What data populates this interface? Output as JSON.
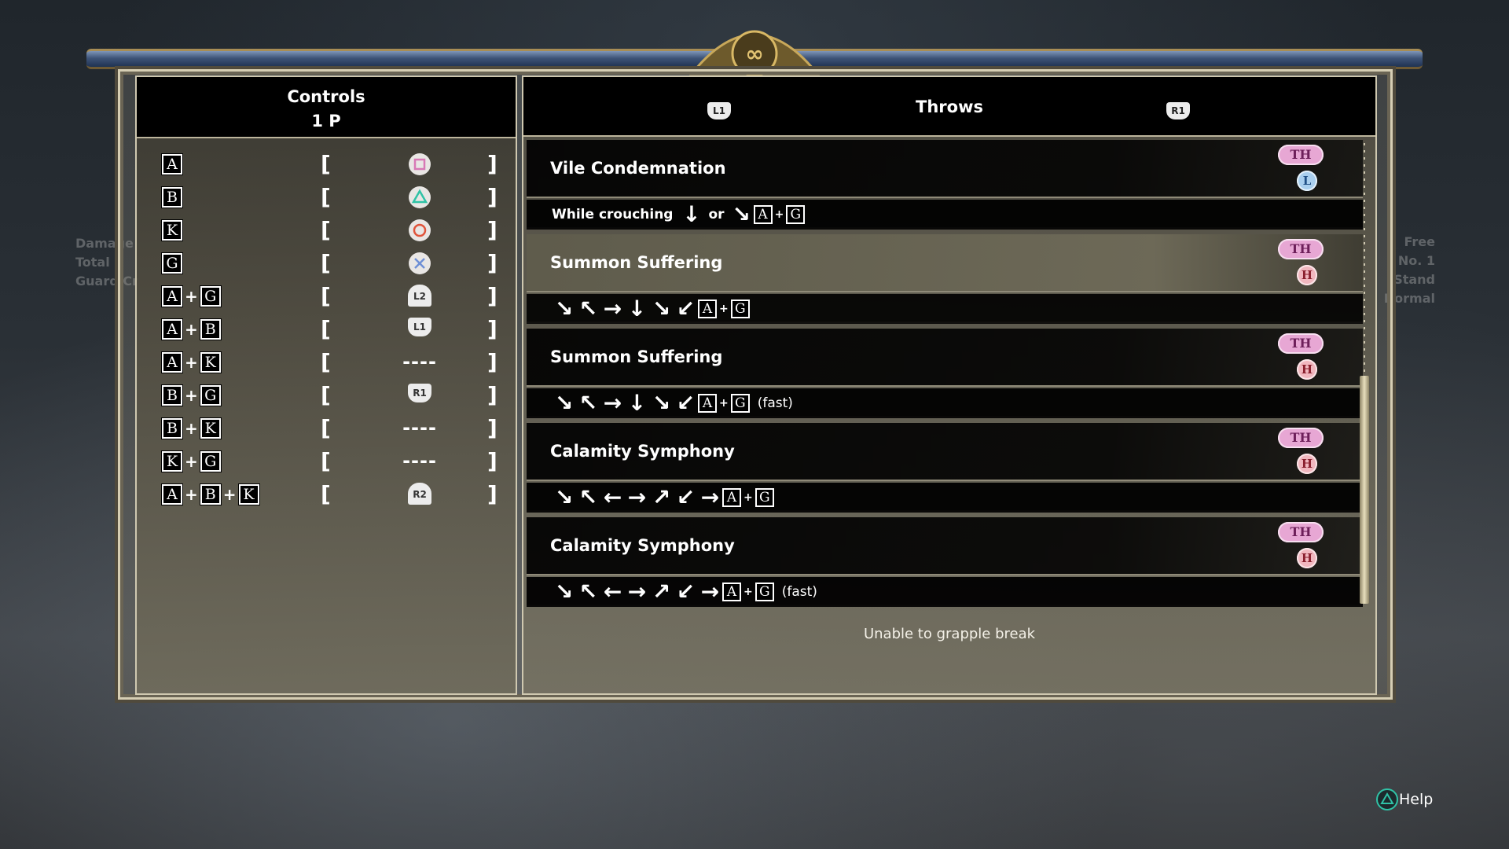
{
  "background": {
    "left_stats": [
      "Damage",
      "Total",
      "Guard Cr"
    ],
    "right_stats": [
      "Free",
      "No. 1",
      "Stand",
      "Normal"
    ]
  },
  "controls": {
    "title": "Controls",
    "player": "1 P",
    "rows": [
      {
        "keys": [
          "A"
        ],
        "button": "square-icon",
        "label": ""
      },
      {
        "keys": [
          "B"
        ],
        "button": "triangle-icon",
        "label": ""
      },
      {
        "keys": [
          "K"
        ],
        "button": "circle-icon",
        "label": ""
      },
      {
        "keys": [
          "G"
        ],
        "button": "cross-icon",
        "label": ""
      },
      {
        "keys": [
          "A",
          "G"
        ],
        "button": "l2-trigger",
        "label": "L2"
      },
      {
        "keys": [
          "A",
          "B"
        ],
        "button": "l1-shoulder",
        "label": "L1"
      },
      {
        "keys": [
          "A",
          "K"
        ],
        "button": "none",
        "label": "----"
      },
      {
        "keys": [
          "B",
          "G"
        ],
        "button": "r1-shoulder",
        "label": "R1"
      },
      {
        "keys": [
          "B",
          "K"
        ],
        "button": "none",
        "label": "----"
      },
      {
        "keys": [
          "K",
          "G"
        ],
        "button": "none",
        "label": "----"
      },
      {
        "keys": [
          "A",
          "B",
          "K"
        ],
        "button": "r2-trigger",
        "label": "R2"
      }
    ],
    "bracket_open": "[",
    "bracket_close": "]"
  },
  "throws": {
    "title": "Throws",
    "prev_tab_button": "L1",
    "next_tab_button": "R1",
    "moves": [
      {
        "name": "Vile Condemnation",
        "type_tag": "TH",
        "level_tag": "L",
        "prefix": "While crouching",
        "alt_word": "or",
        "command": [
          "↓",
          "or",
          "↘",
          "A",
          "+",
          "G"
        ],
        "suffix": ""
      },
      {
        "name": "Summon Suffering",
        "type_tag": "TH",
        "level_tag": "H",
        "prefix": "",
        "command": [
          "↘",
          "↖",
          "→",
          "↓",
          "↘",
          "↙",
          "A",
          "+",
          "G"
        ],
        "suffix": ""
      },
      {
        "name": "Summon Suffering",
        "type_tag": "TH",
        "level_tag": "H",
        "prefix": "",
        "command": [
          "↘",
          "↖",
          "→",
          "↓",
          "↘",
          "↙",
          "A",
          "+",
          "G"
        ],
        "suffix": "(fast)"
      },
      {
        "name": "Calamity Symphony",
        "type_tag": "TH",
        "level_tag": "H",
        "prefix": "",
        "command": [
          "↘",
          "↖",
          "←",
          "→",
          "↗",
          "↙",
          "→",
          "A",
          "+",
          "G"
        ],
        "suffix": ""
      },
      {
        "name": "Calamity Symphony",
        "type_tag": "TH",
        "level_tag": "H",
        "prefix": "",
        "command": [
          "↘",
          "↖",
          "←",
          "→",
          "↗",
          "↙",
          "→",
          "A",
          "+",
          "G"
        ],
        "suffix": "(fast)"
      }
    ],
    "note": "Unable to grapple break"
  },
  "help": {
    "icon": "triangle-icon",
    "label": "Help"
  },
  "colors": {
    "th_tag": "#e7a7d4",
    "low_tag": "#a9cfee",
    "high_tag": "#f1b7bf",
    "frame": "#d6ceb4",
    "triangle": "#30c2a6",
    "circle": "#e0533a",
    "square": "#d879b6",
    "cross": "#6f8fd6"
  }
}
